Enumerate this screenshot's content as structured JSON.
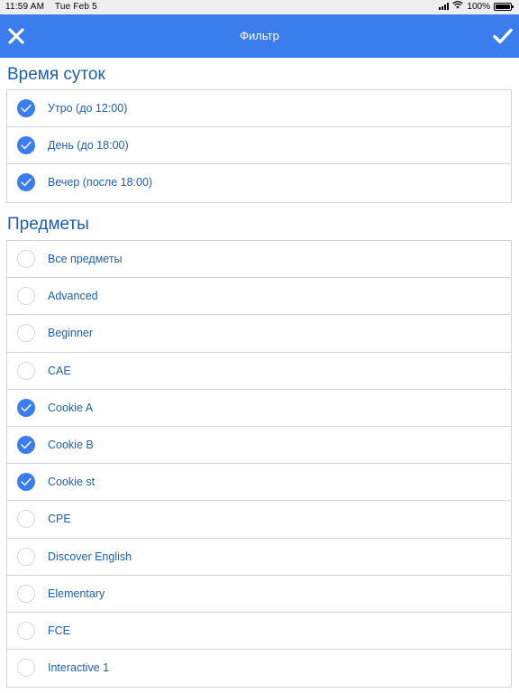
{
  "status_bar": {
    "time": "11:59 AM",
    "date": "Tue Feb 5",
    "battery": "100%",
    "battery_level": 1.0
  },
  "nav": {
    "title": "Фильтр",
    "close_icon": "close-icon",
    "apply_icon": "checkmark-icon",
    "accent_color": "#3b7ded"
  },
  "time_of_day": {
    "heading": "Время суток",
    "items": [
      {
        "label": "Утро (до 12:00)",
        "checked": true
      },
      {
        "label": "День (до 18:00)",
        "checked": true
      },
      {
        "label": "Вечер (после 18:00)",
        "checked": true
      }
    ]
  },
  "subjects": {
    "heading": "Предметы",
    "items": [
      {
        "label": "Все предметы",
        "checked": false
      },
      {
        "label": "Advanced",
        "checked": false
      },
      {
        "label": "Beginner",
        "checked": false
      },
      {
        "label": "CAE",
        "checked": false
      },
      {
        "label": "Cookie A",
        "checked": true
      },
      {
        "label": "Cookie B",
        "checked": true
      },
      {
        "label": "Cookie st",
        "checked": true
      },
      {
        "label": "CPE",
        "checked": false
      },
      {
        "label": "Discover English",
        "checked": false
      },
      {
        "label": "Elementary",
        "checked": false
      },
      {
        "label": "FCE",
        "checked": false
      },
      {
        "label": "Interactive 1",
        "checked": false
      }
    ]
  }
}
